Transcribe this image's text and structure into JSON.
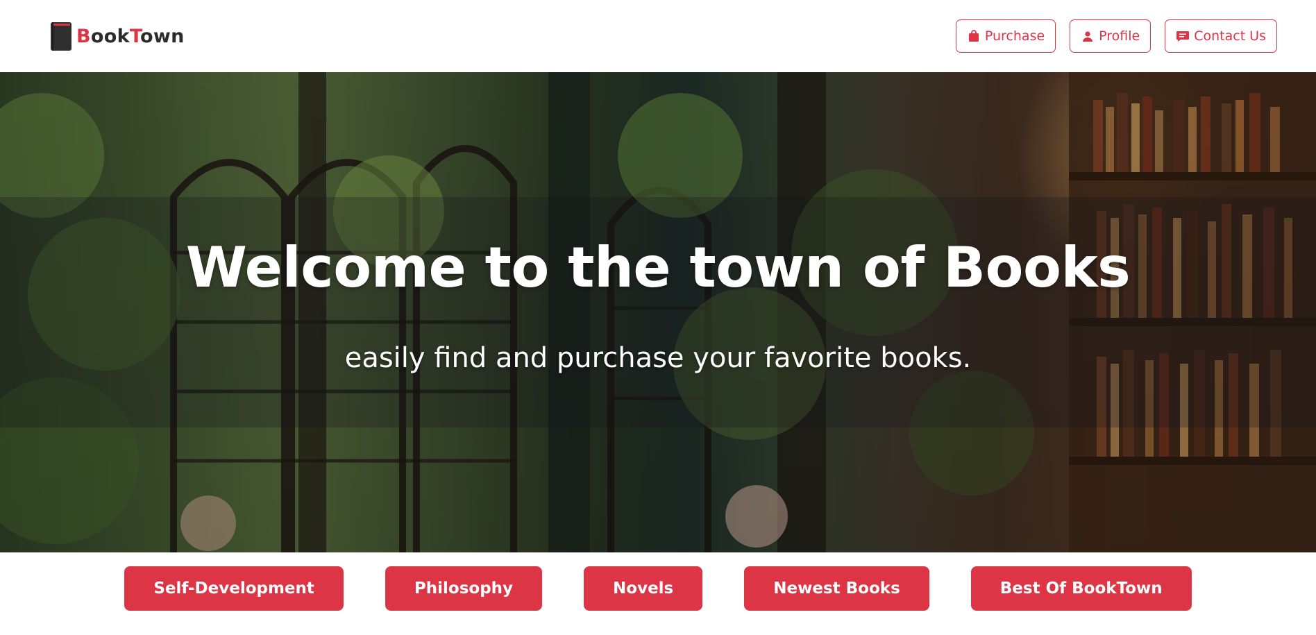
{
  "brand": {
    "name_first_letter": "B",
    "name_part1": "ook",
    "name_second_letter": "T",
    "name_part2": "own",
    "icon": "book-icon"
  },
  "nav": {
    "purchase": {
      "label": "Purchase",
      "icon": "shopping-bag-icon"
    },
    "profile": {
      "label": "Profile",
      "icon": "person-icon"
    },
    "contact": {
      "label": "Contact Us",
      "icon": "chat-bubble-icon"
    }
  },
  "hero": {
    "title": "Welcome to the town of Books",
    "subtitle": "easily find and purchase your favorite books."
  },
  "categories": [
    {
      "label": "Self-Development"
    },
    {
      "label": "Philosophy"
    },
    {
      "label": "Novels"
    },
    {
      "label": "Newest Books"
    },
    {
      "label": "Best Of BookTown"
    }
  ],
  "colors": {
    "accent": "#dc3545",
    "brand_text": "#2b2b2b",
    "background": "#ffffff"
  }
}
